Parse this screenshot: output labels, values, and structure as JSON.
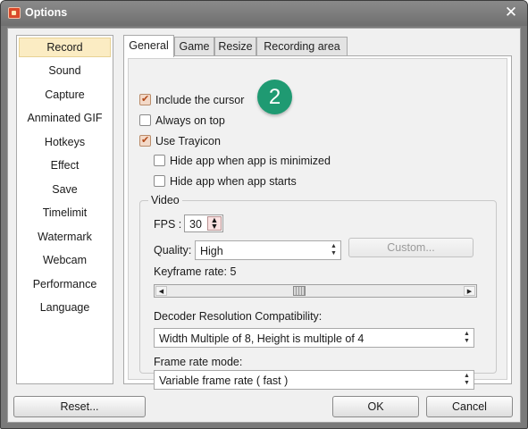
{
  "window": {
    "title": "Options",
    "close_glyph": "✕"
  },
  "sidebar": {
    "items": [
      {
        "label": "Record",
        "active": true
      },
      {
        "label": "Sound"
      },
      {
        "label": "Capture"
      },
      {
        "label": "Anminated GIF"
      },
      {
        "label": "Hotkeys"
      },
      {
        "label": "Effect"
      },
      {
        "label": "Save"
      },
      {
        "label": "Timelimit"
      },
      {
        "label": "Watermark"
      },
      {
        "label": "Webcam"
      },
      {
        "label": "Performance"
      },
      {
        "label": "Language"
      }
    ]
  },
  "tabs": [
    {
      "label": "General",
      "active": true
    },
    {
      "label": "Game"
    },
    {
      "label": "Resize"
    },
    {
      "label": "Recording area"
    }
  ],
  "general": {
    "include_cursor": {
      "label": "Include the cursor",
      "checked": true
    },
    "always_on_top": {
      "label": "Always on top",
      "checked": false
    },
    "use_trayicon": {
      "label": "Use Trayicon",
      "checked": true
    },
    "hide_minimized": {
      "label": "Hide app when app is minimized",
      "checked": false
    },
    "hide_starts": {
      "label": "Hide app when app starts",
      "checked": false
    },
    "video": {
      "group_title": "Video",
      "fps_label": "FPS :",
      "fps_value": "30",
      "quality_label": "Quality:",
      "quality_value": "High",
      "custom_button": "Custom...",
      "keyframe_label": "Keyframe rate: 5",
      "keyframe_value": 5,
      "decoder_label": "Decoder Resolution Compatibility:",
      "decoder_value": "Width Multiple of 8, Height is multiple of 4",
      "frame_mode_label": "Frame rate mode:",
      "frame_mode_value": "Variable frame rate ( fast )"
    }
  },
  "annotation_badge": "2",
  "buttons": {
    "reset": "Reset...",
    "ok": "OK",
    "cancel": "Cancel"
  },
  "colors": {
    "accent_badge": "#1f9a72",
    "selected_item": "#fbecc3",
    "title_bar": "#7a7a7a"
  },
  "icons": {
    "app": "app-logo-icon",
    "close": "close-icon",
    "spin": "spin-arrows-icon",
    "dropdown": "dropdown-arrow-icon"
  }
}
